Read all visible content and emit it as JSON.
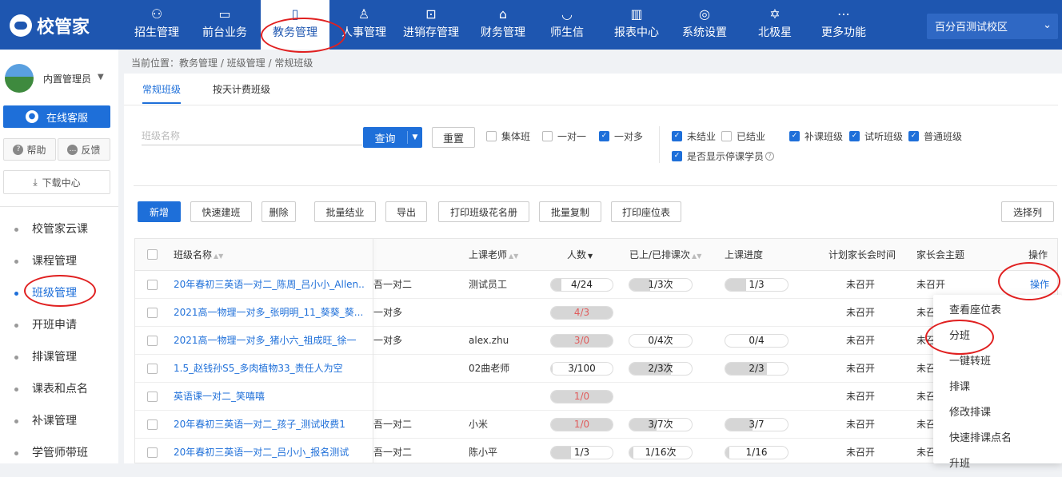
{
  "brand": {
    "logo_text": "校管家"
  },
  "nav": [
    {
      "label": "招生管理",
      "icon": "person-add-icon",
      "glyph": "⚇"
    },
    {
      "label": "前台业务",
      "icon": "reception-icon",
      "glyph": "▭"
    },
    {
      "label": "教务管理",
      "icon": "academic-icon",
      "glyph": "▯"
    },
    {
      "label": "人事管理",
      "icon": "person-icon",
      "glyph": "♙"
    },
    {
      "label": "进销存管理",
      "icon": "inventory-icon",
      "glyph": "⊡"
    },
    {
      "label": "财务管理",
      "icon": "finance-icon",
      "glyph": "⌂"
    },
    {
      "label": "师生信",
      "icon": "message-icon",
      "glyph": "◡"
    },
    {
      "label": "报表中心",
      "icon": "report-icon",
      "glyph": "▥"
    },
    {
      "label": "系统设置",
      "icon": "settings-icon",
      "glyph": "◎"
    },
    {
      "label": "北极星",
      "icon": "star-icon",
      "glyph": "✡"
    },
    {
      "label": "更多功能",
      "icon": "more-icon",
      "glyph": "⋯"
    }
  ],
  "school_selector": {
    "value": "百分百测试校区",
    "chevron": "⌄"
  },
  "user": {
    "name": "内置管理员",
    "caret": "▼"
  },
  "sidebar": {
    "online_service": "在线客服",
    "help": "帮助",
    "feedback": "反馈",
    "download": "下载中心",
    "download_glyph": "⤓",
    "items": [
      {
        "label": "校管家云课"
      },
      {
        "label": "课程管理"
      },
      {
        "label": "班级管理",
        "active": true
      },
      {
        "label": "开班申请"
      },
      {
        "label": "排课管理"
      },
      {
        "label": "课表和点名"
      },
      {
        "label": "补课管理"
      },
      {
        "label": "学管师带班"
      }
    ]
  },
  "breadcrumb": "当前位置：教务管理 / 班级管理 / 常规班级",
  "tabs": [
    {
      "label": "常规班级",
      "active": true
    },
    {
      "label": "按天计费班级"
    }
  ],
  "search": {
    "placeholder": "班级名称",
    "value": "",
    "query_label": "查询",
    "reset_label": "重置"
  },
  "filters": {
    "class_type": [
      {
        "label": "集体班",
        "checked": false
      },
      {
        "label": "一对一",
        "checked": false
      },
      {
        "label": "一对多",
        "checked": true
      }
    ],
    "status": [
      {
        "label": "未结业",
        "checked": true
      },
      {
        "label": "已结业",
        "checked": false
      }
    ],
    "category": [
      {
        "label": "补课班级",
        "checked": true
      },
      {
        "label": "试听班级",
        "checked": true
      },
      {
        "label": "普通班级",
        "checked": true
      }
    ],
    "show_paused": {
      "label": "是否显示停课学员",
      "checked": true
    }
  },
  "toolbar": {
    "buttons": [
      "新增",
      "快速建班",
      "删除",
      "批量结业",
      "导出",
      "打印班级花名册",
      "批量复制",
      "打印座位表"
    ],
    "select_columns": "选择列"
  },
  "table": {
    "headers": {
      "name": "班级名称",
      "teacher": "上课老师",
      "count": "人数",
      "lessons": "已上/已排课次",
      "progress": "上课进度",
      "meeting_time": "计划家长会时间",
      "meeting_topic": "家长会主题",
      "action": "操作"
    },
    "rows": [
      {
        "name": "20年春初三英语一对二_陈周_吕小小_Allen...",
        "type": "吾一对二",
        "teacher": "测试员工",
        "count": "4/24",
        "count_fill": 0.17,
        "count_red": false,
        "lessons": "1/3次",
        "lessons_fill": 0.33,
        "progress": "1/3",
        "progress_fill": 0.33,
        "meeting": "未召开",
        "topic": "未召开",
        "action": "操作"
      },
      {
        "name": "2021高一物理一对多_张明明_11_葵葵_葵...",
        "type": "一对多",
        "teacher": "",
        "count": "4/3",
        "count_fill": 1,
        "count_red": true,
        "lessons": "",
        "lessons_fill": 0,
        "progress": "",
        "progress_fill": 0,
        "meeting": "未召开",
        "topic": "未召",
        "action": ""
      },
      {
        "name": "2021高一物理一对多_猪小六_祖成旺_徐一",
        "type": "一对多",
        "teacher": "alex.zhu",
        "count": "3/0",
        "count_fill": 1,
        "count_red": true,
        "lessons": "0/4次",
        "lessons_fill": 0,
        "progress": "0/4",
        "progress_fill": 0,
        "meeting": "未召开",
        "topic": "未召",
        "action": ""
      },
      {
        "name": "1.5_赵钱孙S5_多肉植物33_责任人为空",
        "type": "",
        "teacher": "02曲老师",
        "count": "3/100",
        "count_fill": 0.03,
        "count_red": false,
        "lessons": "2/3次",
        "lessons_fill": 0.67,
        "progress": "2/3",
        "progress_fill": 0.67,
        "meeting": "未召开",
        "topic": "未召",
        "action": ""
      },
      {
        "name": "英语课一对二_笑嘻嘻",
        "type": "",
        "teacher": "",
        "count": "1/0",
        "count_fill": 1,
        "count_red": true,
        "lessons": "",
        "lessons_fill": 0,
        "progress": "",
        "progress_fill": 0,
        "meeting": "未召开",
        "topic": "未召",
        "action": ""
      },
      {
        "name": "20年春初三英语一对二_孩子_测试收费1",
        "type": "吾一对二",
        "teacher": "小米",
        "count": "1/0",
        "count_fill": 1,
        "count_red": true,
        "lessons": "3/7次",
        "lessons_fill": 0.43,
        "progress": "3/7",
        "progress_fill": 0.43,
        "meeting": "未召开",
        "topic": "未召",
        "action": ""
      },
      {
        "name": "20年春初三英语一对二_吕小小_报名测试",
        "type": "吾一对二",
        "teacher": "陈小平",
        "count": "1/3",
        "count_fill": 0.33,
        "count_red": false,
        "lessons": "1/16次",
        "lessons_fill": 0.06,
        "progress": "1/16",
        "progress_fill": 0.06,
        "meeting": "未召开",
        "topic": "未召",
        "action": ""
      }
    ]
  },
  "action_menu": [
    "查看座位表",
    "分班",
    "一键转班",
    "排课",
    "修改排课",
    "快速排课点名",
    "升班"
  ],
  "colors": {
    "primary": "#1e56b0",
    "accent": "#1e6fd9",
    "annotation": "#e02020",
    "warn": "#e05c5c"
  }
}
